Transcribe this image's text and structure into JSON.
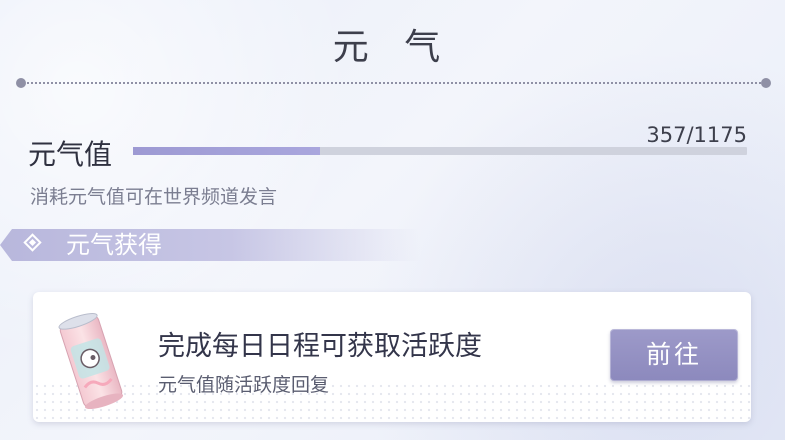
{
  "header": {
    "title": "元 气"
  },
  "stat": {
    "label": "元气值",
    "value_text": "357/1175",
    "current": 357,
    "max": 1175,
    "hint": "消耗元气值可在世界频道发言"
  },
  "section": {
    "title": "元气获得"
  },
  "task": {
    "title": "完成每日日程可获取活跃度",
    "subtitle": "元气值随活跃度回复",
    "button_label": "前往",
    "icon": "energy-can-icon"
  },
  "colors": {
    "accent": "#9d9ad3",
    "button": "#8c89bd",
    "text_dark": "#33354a",
    "text_muted": "#7b7e91"
  }
}
